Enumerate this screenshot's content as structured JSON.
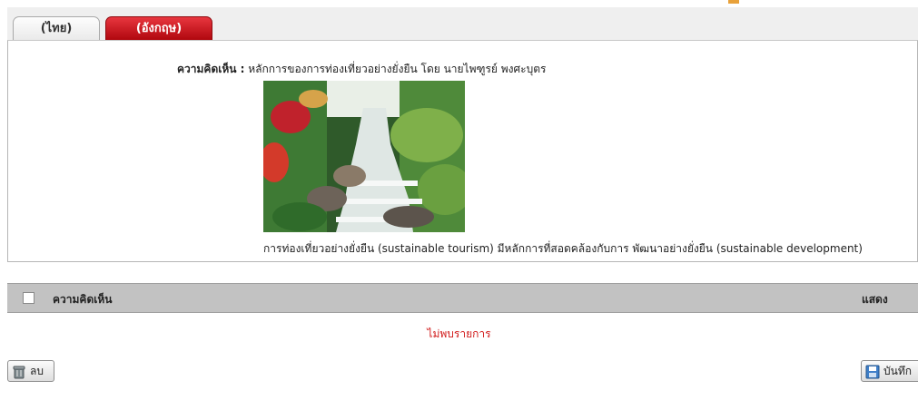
{
  "tabs": [
    {
      "label": "(ไทย)",
      "state": "active"
    },
    {
      "label": "(อังกฤษ)",
      "state": "inactive"
    }
  ],
  "comment": {
    "label": "ความคิดเห็น :",
    "text": "หลักการของการท่องเที่ยวอย่างยั่งยืน โดย นายไพฑูรย์ พงศะบุตร",
    "caption": "การท่องเที่ยวอย่างยั่งยืน (sustainable tourism) มีหลักการที่สอดคล้องกับการ พัฒนาอย่างยั่งยืน (sustainable development)"
  },
  "list": {
    "header_comment": "ความคิดเห็น",
    "header_show": "แสดง",
    "empty_message": "ไม่พบรายการ"
  },
  "buttons": {
    "delete_label": "ลบ",
    "save_label": "บันทึก"
  },
  "colors": {
    "active_tab": "#efefef",
    "inactive_tab": "#c4121a",
    "header_bar": "#c2c2c2",
    "empty_message": "#d11b1b"
  }
}
